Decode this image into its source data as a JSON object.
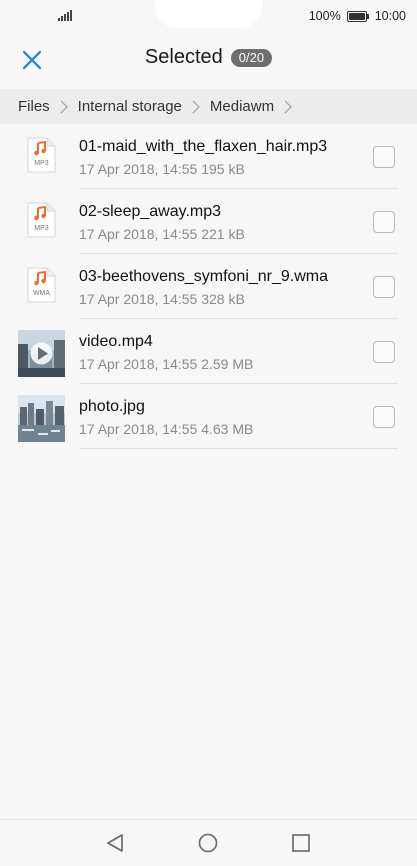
{
  "status_bar": {
    "battery_percent": "100%",
    "time": "10:00",
    "signal_icon": "signal-icon",
    "battery_icon": "battery-icon"
  },
  "header": {
    "title": "Selected",
    "count": "0/20",
    "close_icon": "close-icon",
    "accent_color": "#1a7fdb"
  },
  "breadcrumb": {
    "items": [
      "Files",
      "Internal storage",
      "Mediawm"
    ]
  },
  "files": [
    {
      "name": "01-maid_with_the_flaxen_hair.mp3",
      "meta": "17 Apr 2018, 14:55 195 kB",
      "type": "MP3",
      "icon": "music-file-icon",
      "checked": false
    },
    {
      "name": "02-sleep_away.mp3",
      "meta": "17 Apr 2018, 14:55 221 kB",
      "type": "MP3",
      "icon": "music-file-icon",
      "checked": false
    },
    {
      "name": "03-beethovens_symfoni_nr_9.wma",
      "meta": "17 Apr 2018, 14:55 328 kB",
      "type": "WMA",
      "icon": "music-file-icon",
      "checked": false
    },
    {
      "name": "video.mp4",
      "meta": "17 Apr 2018, 14:55 2.59 MB",
      "type": "video",
      "icon": "video-thumbnail",
      "checked": false
    },
    {
      "name": "photo.jpg",
      "meta": "17 Apr 2018, 14:55 4.63 MB",
      "type": "image",
      "icon": "photo-thumbnail",
      "checked": false
    }
  ],
  "nav_bar": {
    "back_icon": "back-icon",
    "home_icon": "home-icon",
    "recents_icon": "recents-icon"
  },
  "colors": {
    "music_note": "#ef6b35",
    "badge_bg": "#6e6e6e"
  }
}
